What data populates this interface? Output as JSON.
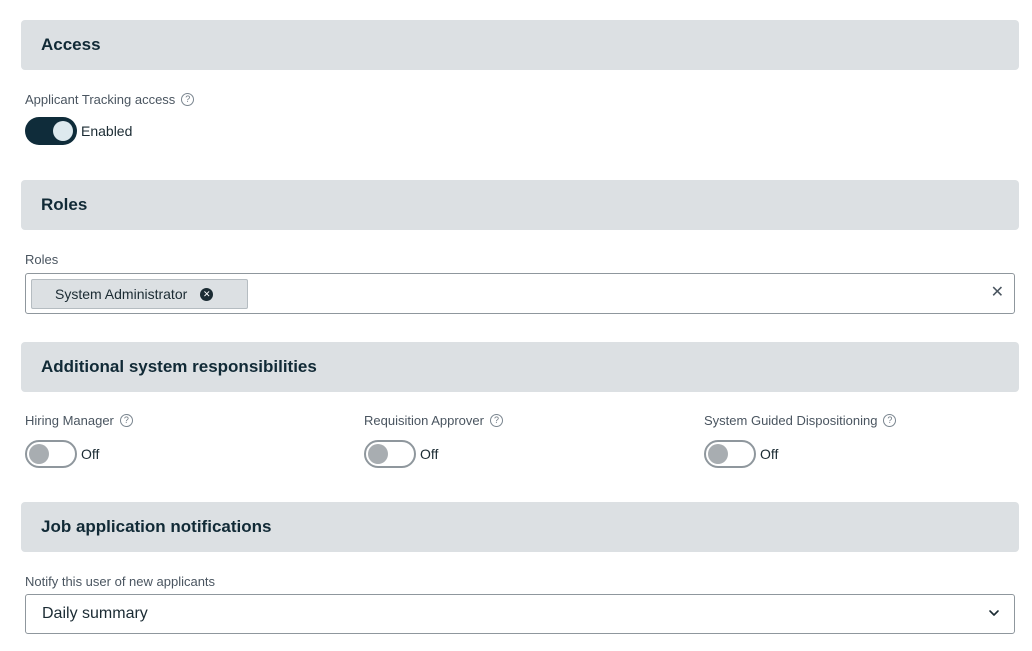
{
  "sections": {
    "access": "Access",
    "roles": "Roles",
    "additional": "Additional system responsibilities",
    "notifications": "Job application notifications"
  },
  "access": {
    "label": "Applicant Tracking access",
    "toggle_state": "Enabled"
  },
  "roles": {
    "label": "Roles",
    "selected": [
      "System Administrator"
    ]
  },
  "responsibilities": [
    {
      "label": "Hiring Manager",
      "state": "Off"
    },
    {
      "label": "Requisition Approver",
      "state": "Off"
    },
    {
      "label": "System Guided Dispositioning",
      "state": "Off"
    }
  ],
  "notifications": {
    "label": "Notify this user of new applicants",
    "value": "Daily summary"
  },
  "icons": {
    "help": "question-circle-icon",
    "chip_remove": "close-circle-icon",
    "clear": "close-icon",
    "dropdown": "chevron-down-icon"
  },
  "colors": {
    "section_bg": "#dce0e3",
    "toggle_on": "#0f2c3a",
    "heading_text": "#112a36"
  }
}
